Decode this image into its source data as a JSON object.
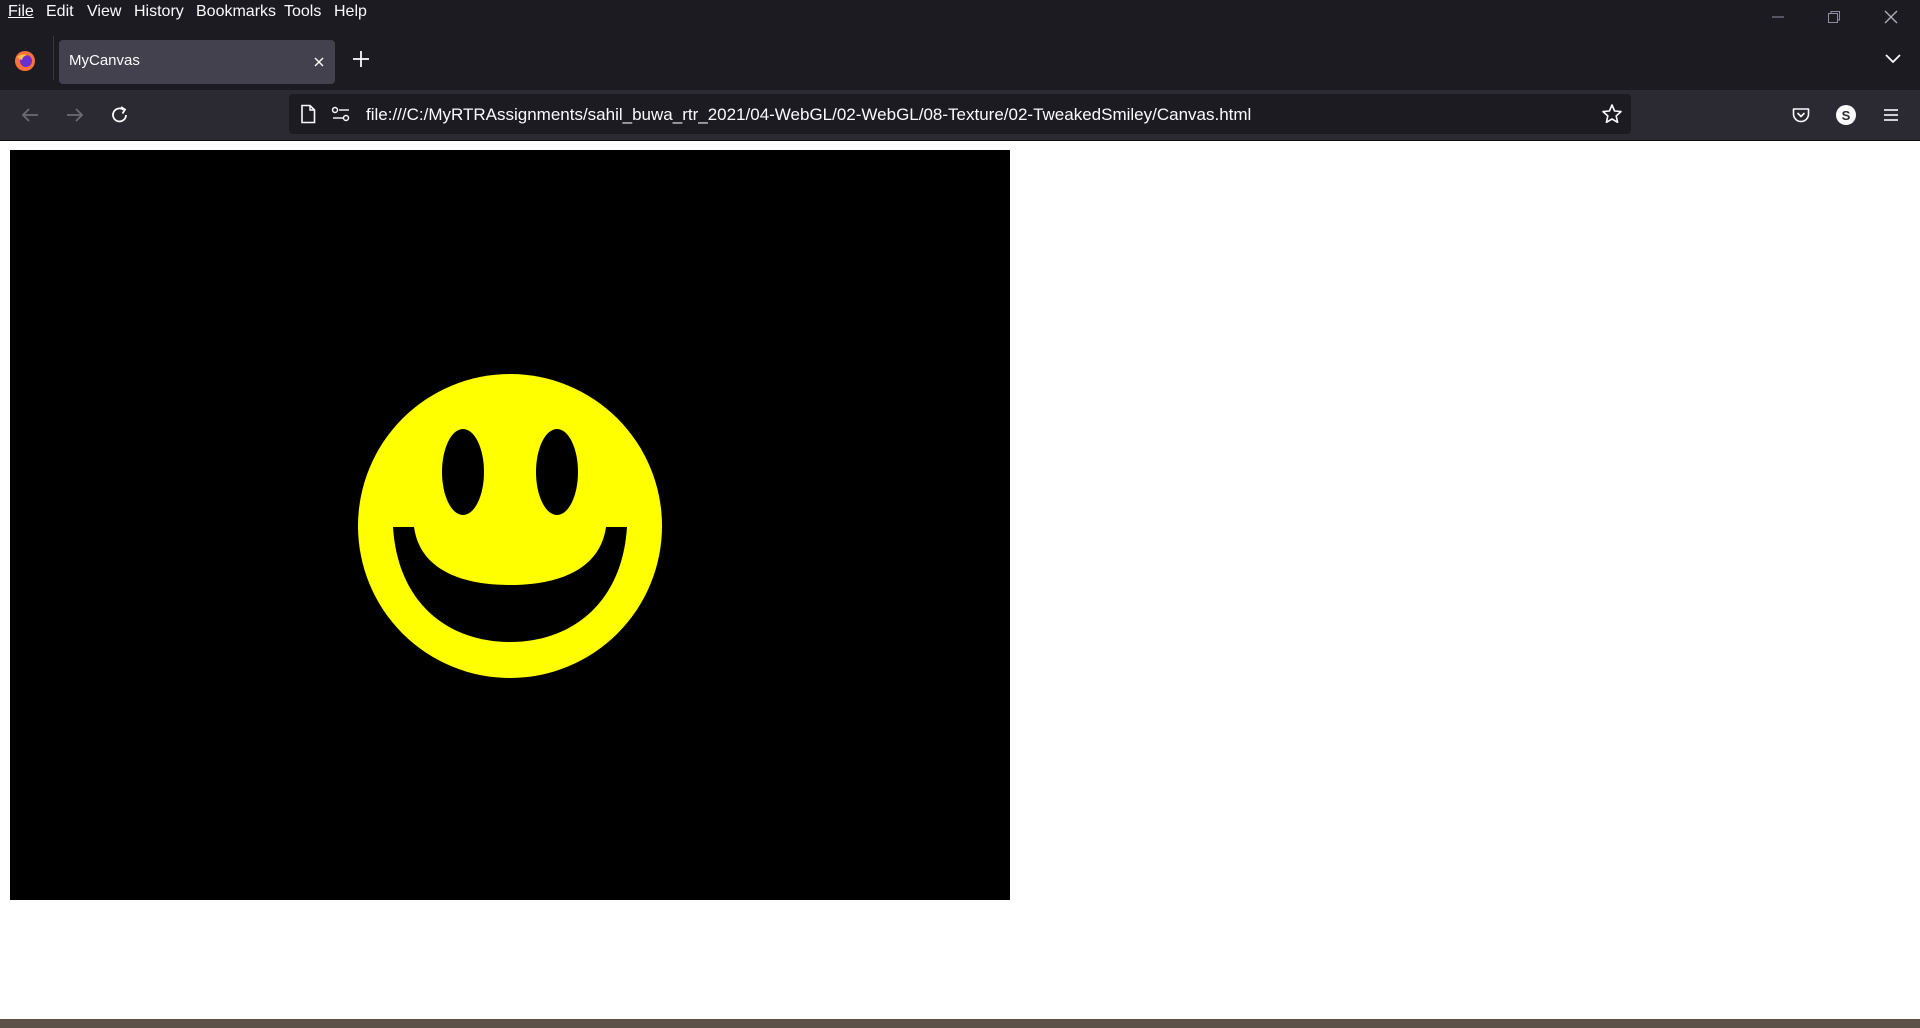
{
  "menubar": {
    "items": [
      {
        "label": "File"
      },
      {
        "label": "Edit"
      },
      {
        "label": "View"
      },
      {
        "label": "History"
      },
      {
        "label": "Bookmarks"
      },
      {
        "label": "Tools"
      },
      {
        "label": "Help"
      }
    ]
  },
  "tab": {
    "title": "MyCanvas"
  },
  "urlbar": {
    "url": "file:///C:/MyRTRAssignments/sahil_buwa_rtr_2021/04-WebGL/02-WebGL/08-Texture/02-TweakedSmiley/Canvas.html"
  },
  "account": {
    "initial": "S"
  },
  "icons": {
    "browser": "firefox-icon",
    "new_tab": "plus-icon",
    "tab_list": "chevron-down-icon",
    "back": "back-arrow-icon",
    "forward": "forward-arrow-icon",
    "reload": "reload-icon",
    "page": "page-icon",
    "permissions": "permissions-icon",
    "bookmark": "star-icon",
    "pocket": "pocket-icon",
    "menu": "hamburger-icon"
  },
  "colors": {
    "chrome_dark": "#1c1b22",
    "toolbar": "#2b2a33",
    "canvas_bg": "#000000",
    "smiley_yellow": "#ffff00"
  }
}
